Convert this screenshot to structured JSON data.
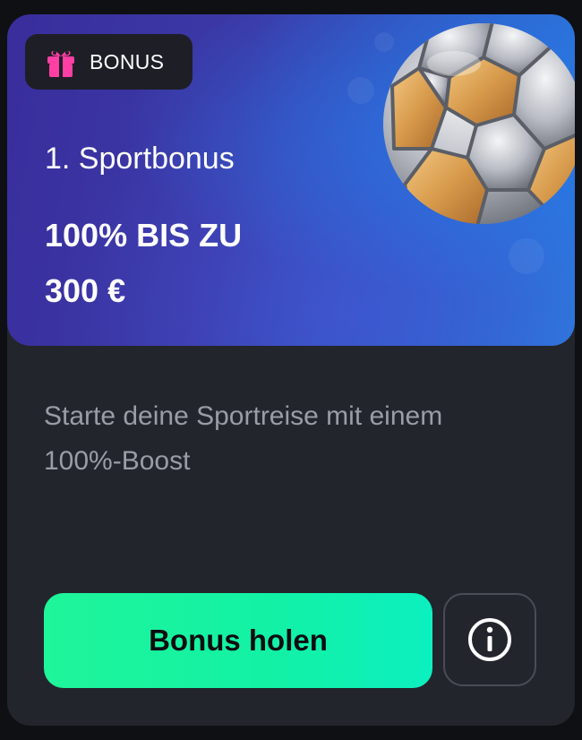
{
  "badge": {
    "label": "BONUS",
    "icon": "gift-icon",
    "icon_color": "#ff3fa4"
  },
  "hero": {
    "subtitle": "1. Sportbonus",
    "offer_line1": "100% BIS ZU",
    "offer_line2": "300 €",
    "image": "football-icon"
  },
  "description": "Starte deine Sportreise mit einem 100%-Boost",
  "actions": {
    "primary_label": "Bonus holen",
    "info_icon": "info-icon"
  },
  "colors": {
    "card_background": "#23252c",
    "accent": "#17f3a0",
    "hero_gradient_start": "#3a2d9c",
    "hero_gradient_end": "#2c78dc"
  }
}
